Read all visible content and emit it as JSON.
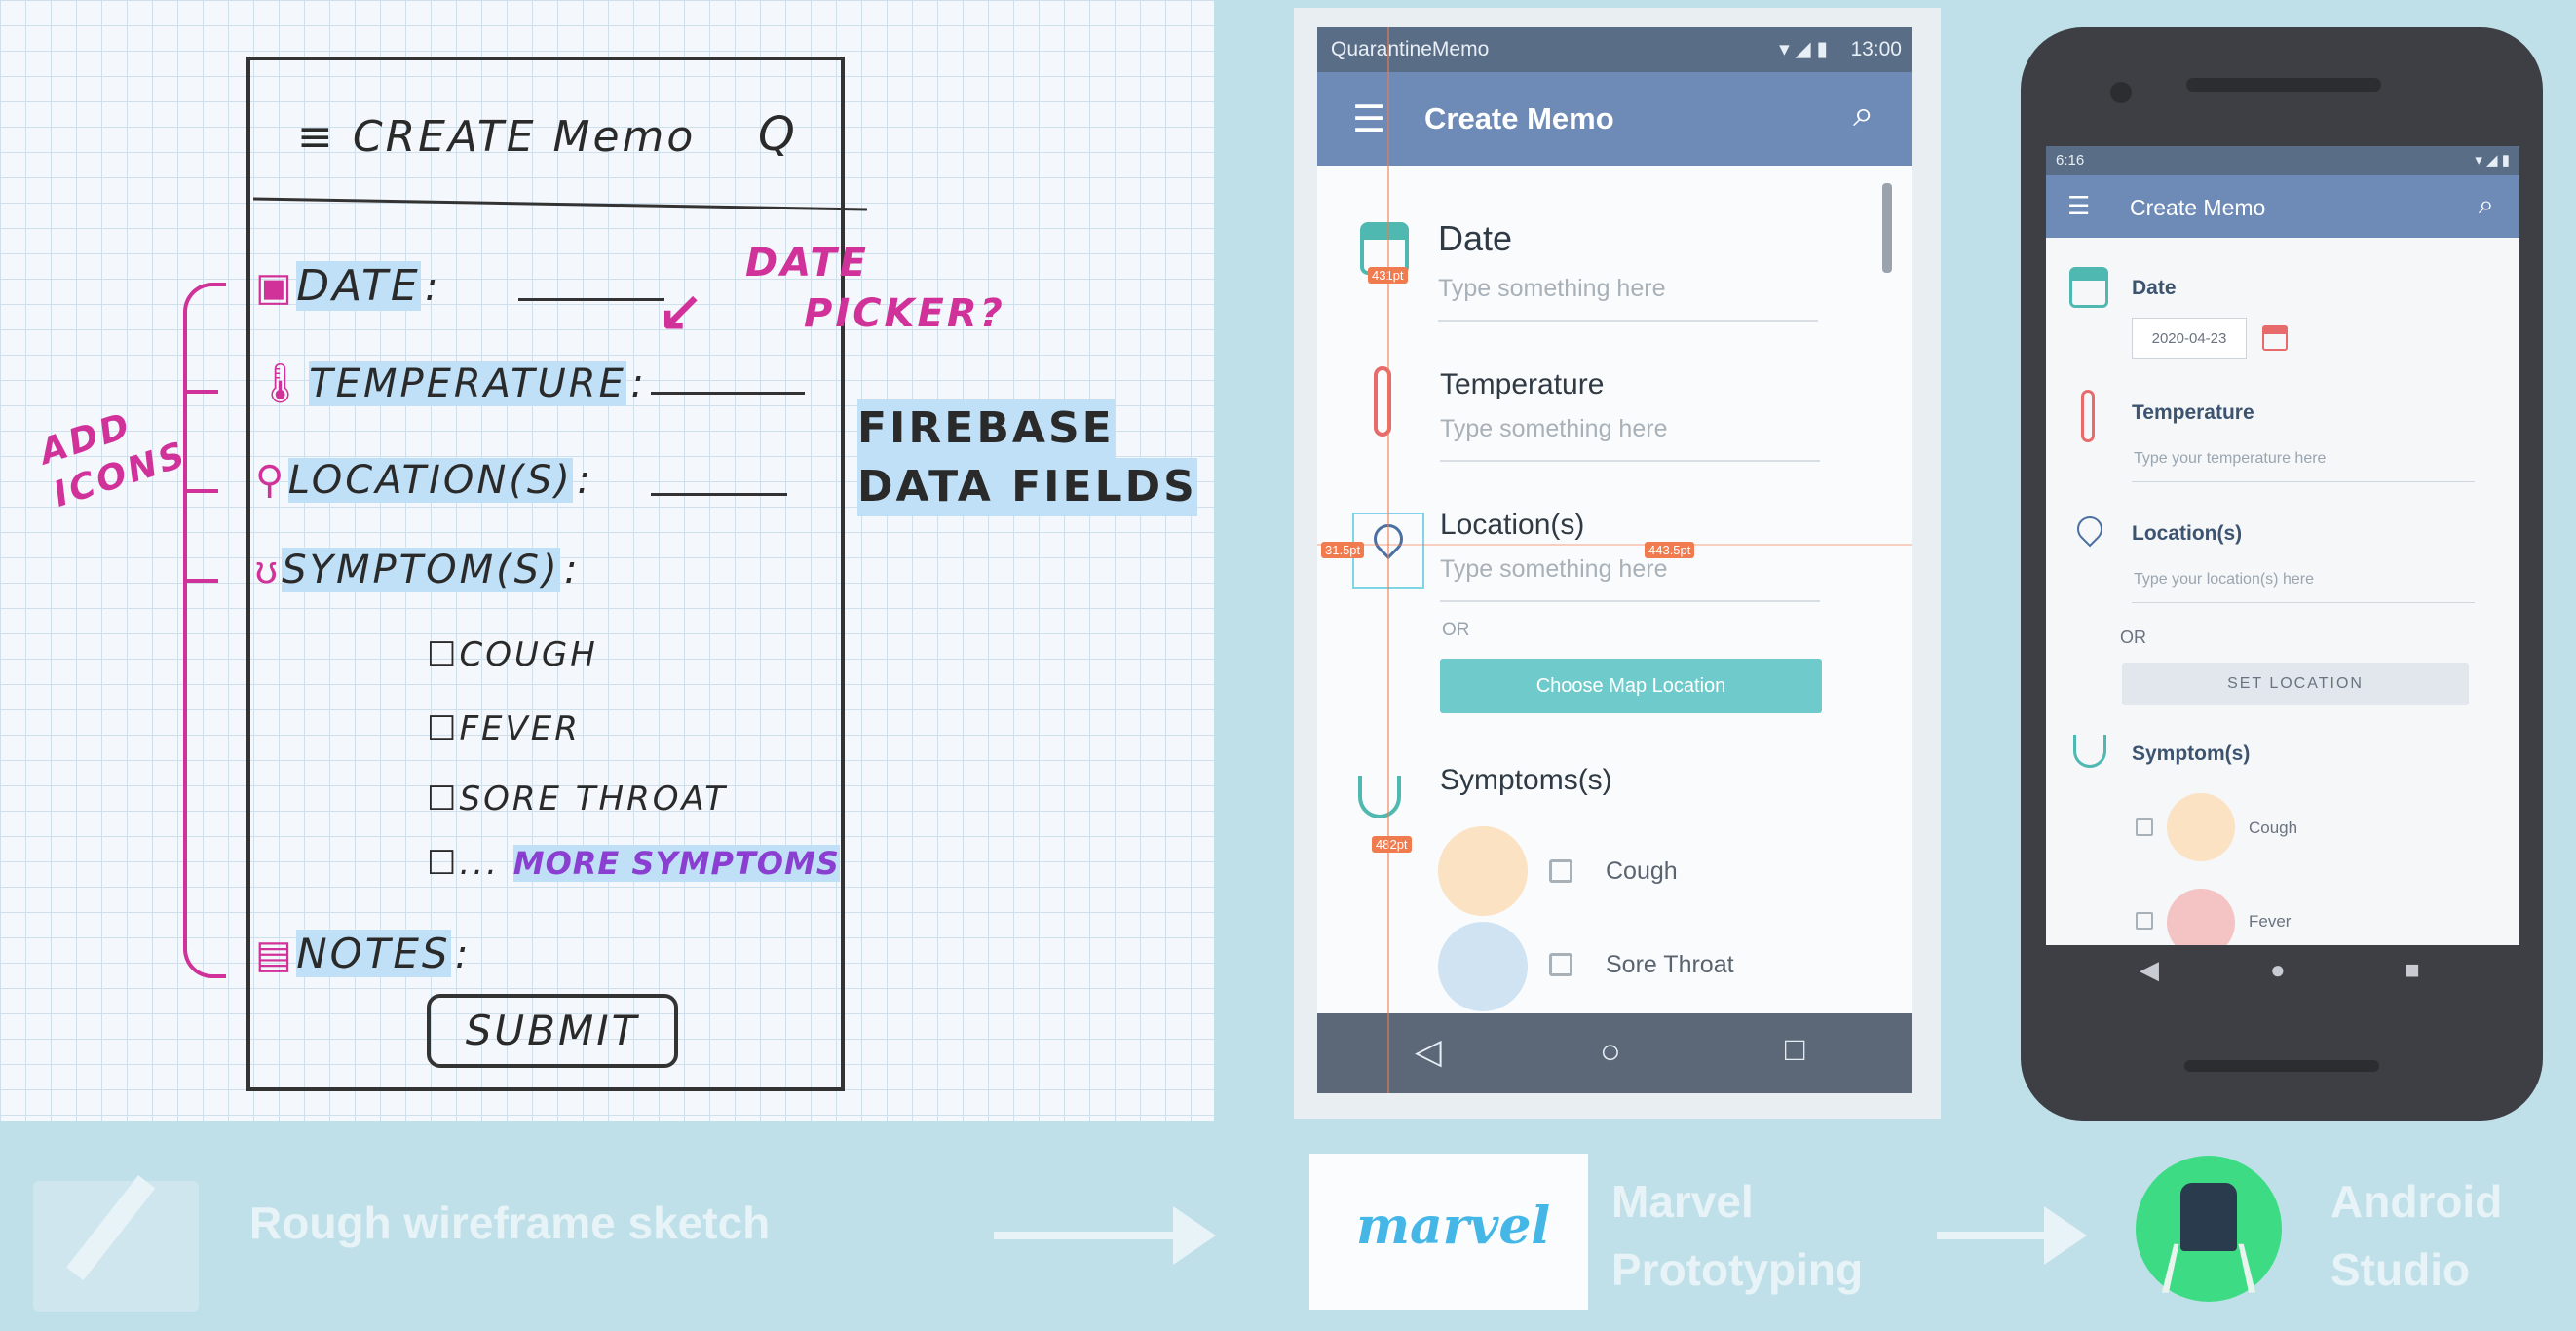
{
  "sketch": {
    "header": "≡ CREATE Memo",
    "search_glyph": "Q",
    "fields": [
      "DATE",
      "TEMPERATURE",
      "LOCATION(S)",
      "SYMPTOM(S)"
    ],
    "field_suffix": ":",
    "checklist": [
      "COUGH",
      "FEVER",
      "SORE THROAT",
      "..."
    ],
    "more_symptoms": "MORE SYMPTOMS",
    "notes": "NOTES",
    "submit": "SUBMIT",
    "annotation_date_picker": [
      "DATE",
      "PICKER?"
    ],
    "annotation_firebase": [
      "FIREBASE",
      "DATA FIELDS"
    ],
    "annotation_add_icons": [
      "ADD",
      "ICONS"
    ]
  },
  "marvel_app": {
    "status_app": "QuarantineMemo",
    "status_time": "13:00",
    "title": "Create Memo",
    "date_label": "Date",
    "date_placeholder": "Type something here",
    "temperature_label": "Temperature",
    "temperature_placeholder": "Type something here",
    "location_label": "Location(s)",
    "location_placeholder": "Type something here",
    "or_text": "OR",
    "map_button": "Choose Map Location",
    "symptoms_label": "Symptoms(s)",
    "symptoms": [
      "Cough",
      "Sore Throat"
    ],
    "measures": [
      "431pt",
      "31.5pt",
      "443.5pt",
      "482pt"
    ]
  },
  "android_app": {
    "status_time": "6:16",
    "title": "Create Memo",
    "date_label": "Date",
    "date_value": "2020-04-23",
    "temperature_label": "Temperature",
    "temperature_placeholder": "Type your temperature here",
    "location_label": "Location(s)",
    "location_placeholder": "Type your location(s) here",
    "or_text": "OR",
    "set_location": "SET LOCATION",
    "symptom_label": "Symptom(s)",
    "symptoms": [
      "Cough",
      "Fever"
    ]
  },
  "captions": {
    "sketch": "Rough wireframe sketch",
    "marvel_logo": "marvel",
    "marvel": [
      "Marvel",
      "Prototyping"
    ],
    "android": [
      "Android",
      "Studio"
    ]
  },
  "colors": {
    "sketch_pink": "#d0329a",
    "sketch_purple": "#8a3fd1",
    "highlight": "#bfe0f7",
    "marvel_bar": "#6e8bb8",
    "marvel_button": "#6fcbcb",
    "android_green": "#3ddc84"
  }
}
